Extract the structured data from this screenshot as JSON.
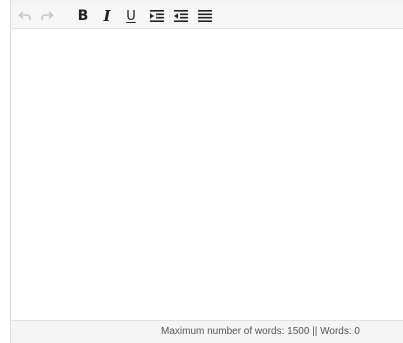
{
  "toolbar": {
    "buttons": [
      {
        "name": "undo",
        "icon": "undo-icon",
        "enabled": false
      },
      {
        "name": "redo",
        "icon": "redo-icon",
        "enabled": false
      },
      {
        "name": "bold",
        "label": "B"
      },
      {
        "name": "italic",
        "label": "I"
      },
      {
        "name": "underline",
        "label": "U"
      },
      {
        "name": "indent",
        "icon": "indent-icon"
      },
      {
        "name": "outdent",
        "icon": "outdent-icon"
      },
      {
        "name": "justify",
        "icon": "align-justify-icon"
      }
    ]
  },
  "editor": {
    "content": ""
  },
  "status": {
    "text": "Maximum number of words: 1500 || Words: 0"
  },
  "colors": {
    "toolbar_bg": "#f6f6f6",
    "disabled_icon": "#c8c8c8",
    "icon": "#222222",
    "status_text": "#555555"
  }
}
